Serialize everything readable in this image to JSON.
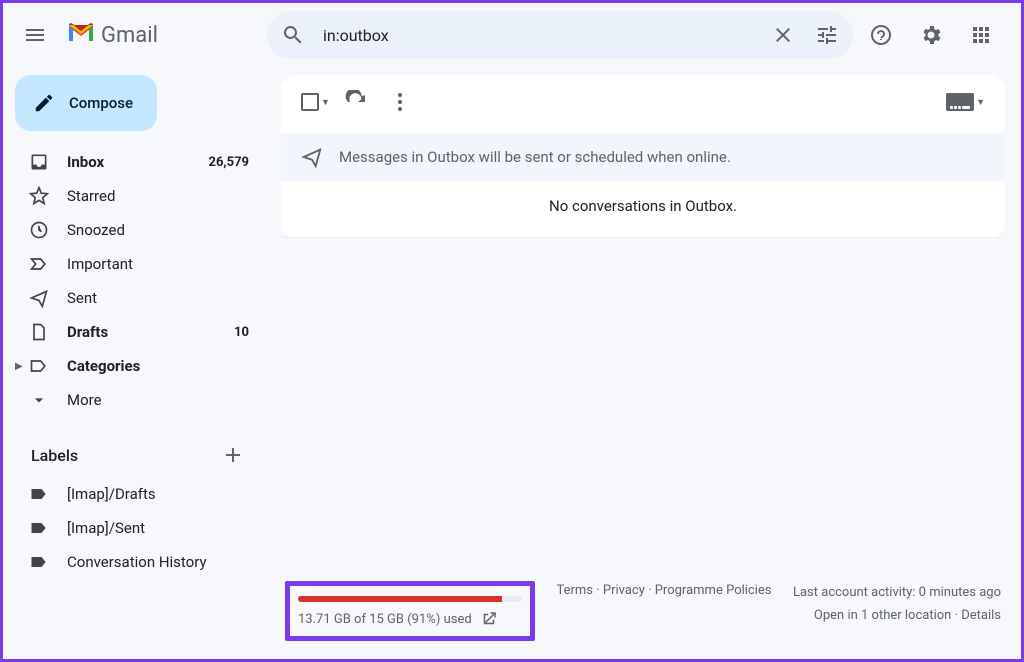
{
  "app_name": "Gmail",
  "search": {
    "value": "in:outbox"
  },
  "compose_label": "Compose",
  "nav": [
    {
      "icon": "inbox",
      "label": "Inbox",
      "count": "26,579",
      "bold": true
    },
    {
      "icon": "star",
      "label": "Starred",
      "count": "",
      "bold": false
    },
    {
      "icon": "clock",
      "label": "Snoozed",
      "count": "",
      "bold": false
    },
    {
      "icon": "important",
      "label": "Important",
      "count": "",
      "bold": false
    },
    {
      "icon": "sent",
      "label": "Sent",
      "count": "",
      "bold": false
    },
    {
      "icon": "drafts",
      "label": "Drafts",
      "count": "10",
      "bold": true
    },
    {
      "icon": "categories",
      "label": "Categories",
      "count": "",
      "bold": true
    },
    {
      "icon": "more",
      "label": "More",
      "count": "",
      "bold": false
    }
  ],
  "labels_header": "Labels",
  "labels": [
    {
      "label": "[Imap]/Drafts"
    },
    {
      "label": "[Imap]/Sent"
    },
    {
      "label": "Conversation History"
    }
  ],
  "banner_text": "Messages in Outbox will be sent or scheduled when online.",
  "empty_text": "No conversations in Outbox.",
  "storage": {
    "percent": 91,
    "text": "13.71 GB of 15 GB (91%) used"
  },
  "footer_links": {
    "terms": "Terms",
    "privacy": "Privacy",
    "programme": "Programme Policies"
  },
  "activity": {
    "line1": "Last account activity: 0 minutes ago",
    "line2_prefix": "Open in 1 other location",
    "details": "Details"
  }
}
